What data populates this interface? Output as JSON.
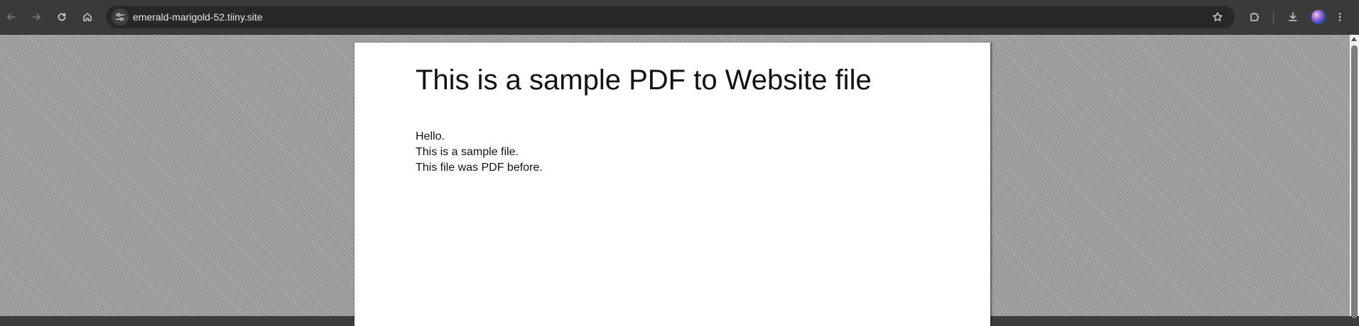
{
  "browser": {
    "url": "emerald-marigold-52.tiiny.site",
    "icons": {
      "back": "arrow-left-icon",
      "forward": "arrow-right-icon",
      "reload": "reload-icon",
      "home": "home-icon",
      "site_info": "tune-icon",
      "bookmark": "star-icon",
      "extensions": "puzzle-icon",
      "downloads": "download-icon",
      "profile": "avatar",
      "menu": "kebab-menu-icon"
    }
  },
  "document": {
    "title": "This is a sample PDF to Website file",
    "lines": [
      "Hello.",
      "This is a sample file.",
      "This file was PDF before."
    ]
  },
  "colors": {
    "toolbar_bg": "#3a3a3a",
    "omnibox_bg": "#282828",
    "page_bg": "#ffffff",
    "viewport_bg": "#9a9a9a"
  }
}
